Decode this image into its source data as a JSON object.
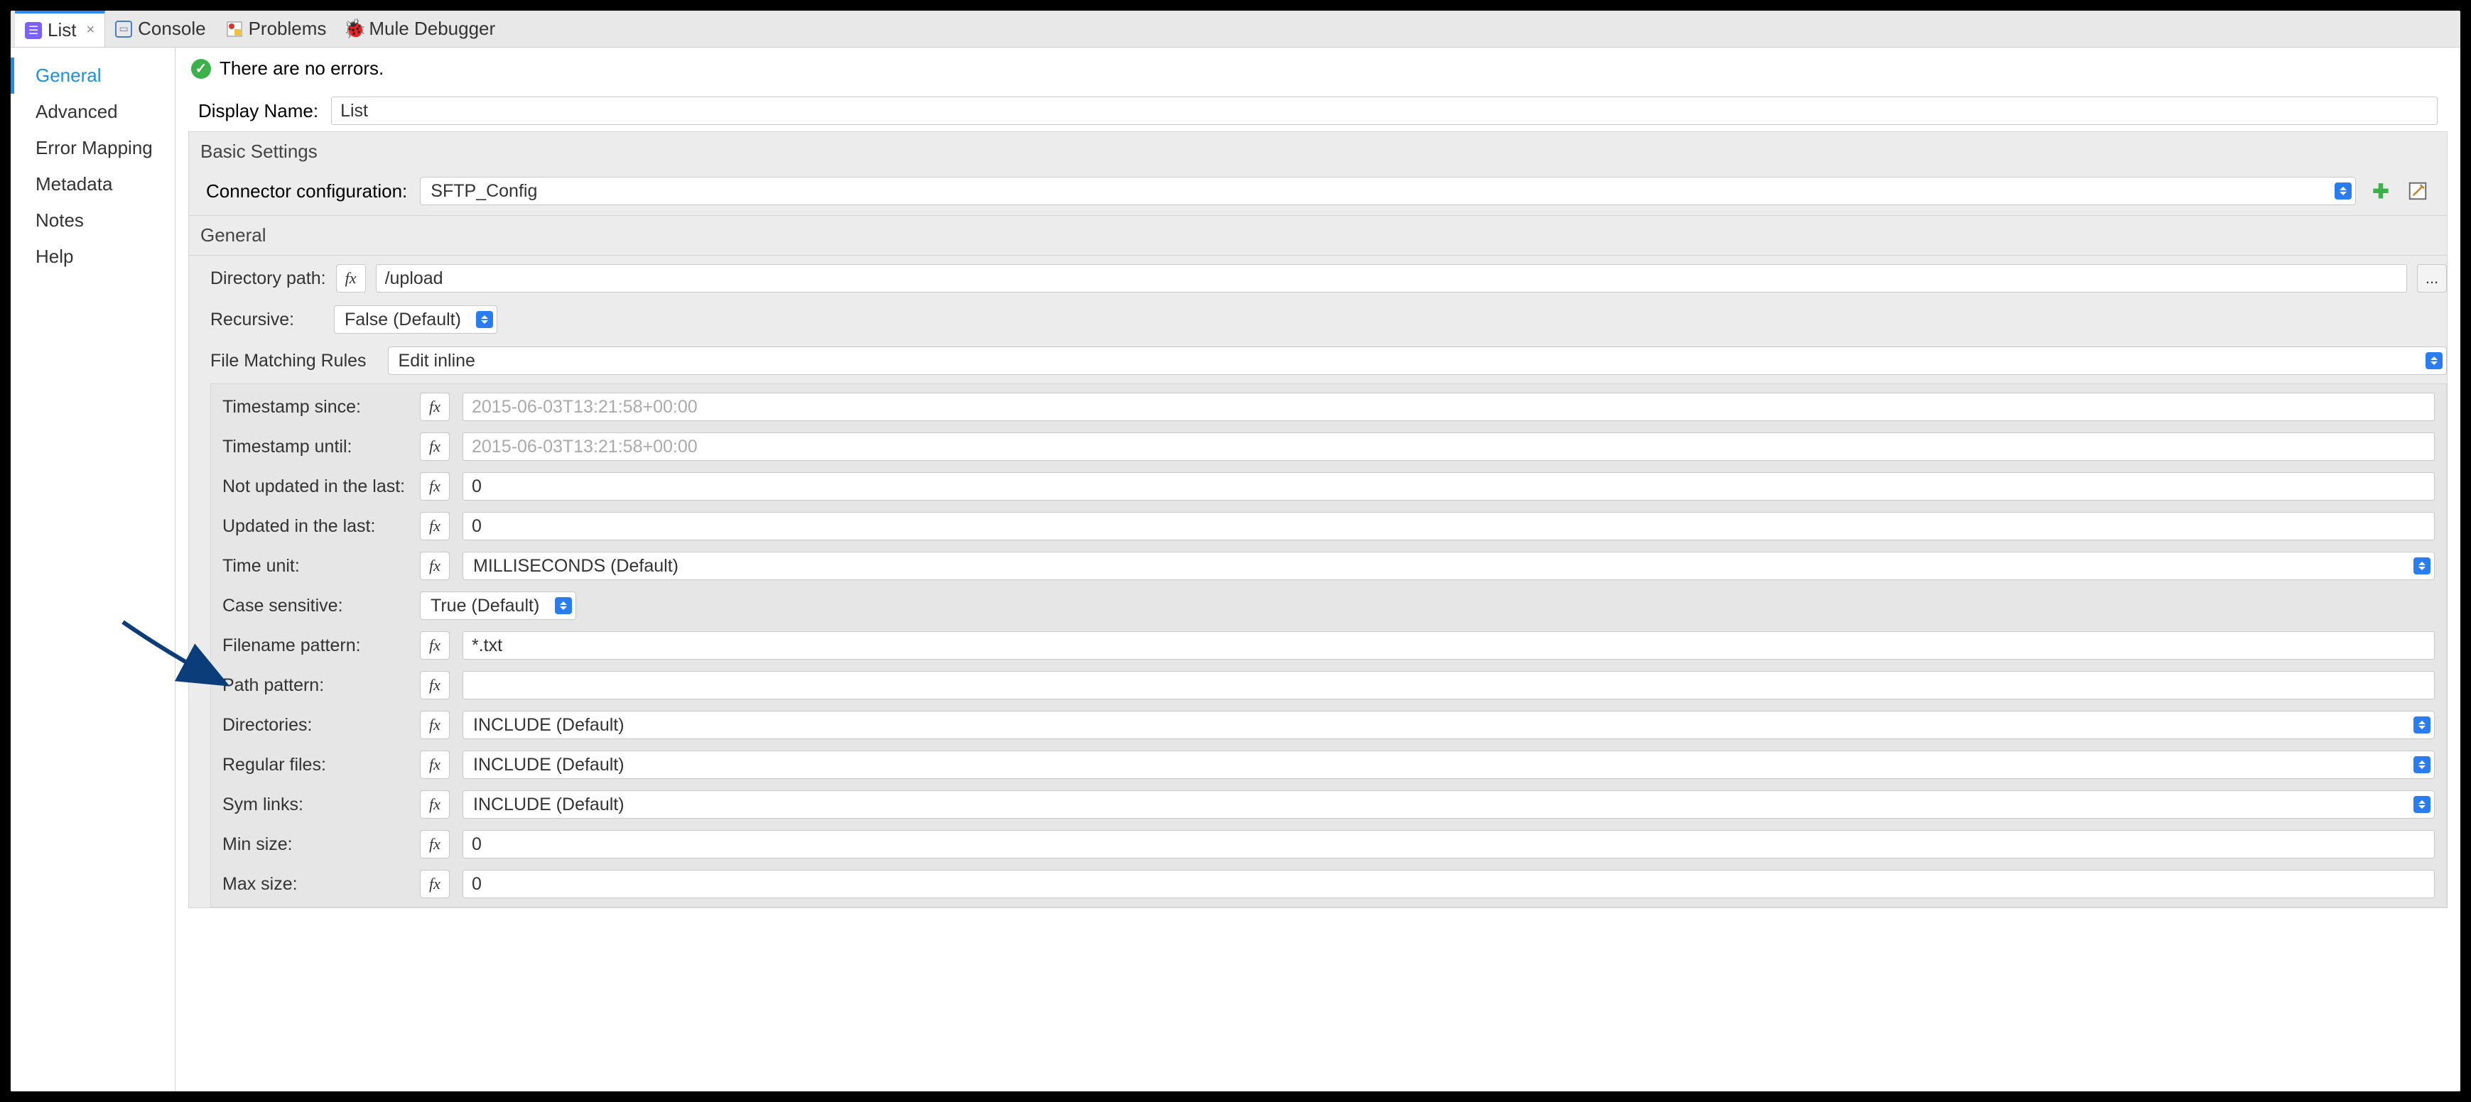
{
  "tabs": {
    "list": "List",
    "console": "Console",
    "problems": "Problems",
    "muleDebugger": "Mule Debugger"
  },
  "sidebar": {
    "items": [
      "General",
      "Advanced",
      "Error Mapping",
      "Metadata",
      "Notes",
      "Help"
    ]
  },
  "status": {
    "message": "There are no errors."
  },
  "display": {
    "nameLabel": "Display Name:",
    "nameValue": "List"
  },
  "basic": {
    "title": "Basic Settings",
    "configLabel": "Connector configuration:",
    "configValue": "SFTP_Config"
  },
  "general": {
    "title": "General",
    "dirLabel": "Directory path:",
    "dirValue": "/upload",
    "recursiveLabel": "Recursive:",
    "recursiveValue": "False (Default)",
    "rulesLabel": "File Matching Rules",
    "rulesMode": "Edit inline",
    "browse": "..."
  },
  "rules": {
    "tsSince": {
      "label": "Timestamp since:",
      "placeholder": "2015-06-03T13:21:58+00:00",
      "value": ""
    },
    "tsUntil": {
      "label": "Timestamp until:",
      "placeholder": "2015-06-03T13:21:58+00:00",
      "value": ""
    },
    "notUpdated": {
      "label": "Not updated in the last:",
      "value": "0"
    },
    "updated": {
      "label": "Updated in the last:",
      "value": "0"
    },
    "timeUnit": {
      "label": "Time unit:",
      "value": "MILLISECONDS (Default)"
    },
    "caseSensitive": {
      "label": "Case sensitive:",
      "value": "True (Default)"
    },
    "filename": {
      "label": "Filename pattern:",
      "value": "*.txt"
    },
    "pathPattern": {
      "label": "Path pattern:",
      "value": ""
    },
    "directories": {
      "label": "Directories:",
      "value": "INCLUDE (Default)"
    },
    "regularFiles": {
      "label": "Regular files:",
      "value": "INCLUDE (Default)"
    },
    "symLinks": {
      "label": "Sym links:",
      "value": "INCLUDE (Default)"
    },
    "minSize": {
      "label": "Min size:",
      "value": "0"
    },
    "maxSize": {
      "label": "Max size:",
      "value": "0"
    }
  },
  "fx": "fx"
}
